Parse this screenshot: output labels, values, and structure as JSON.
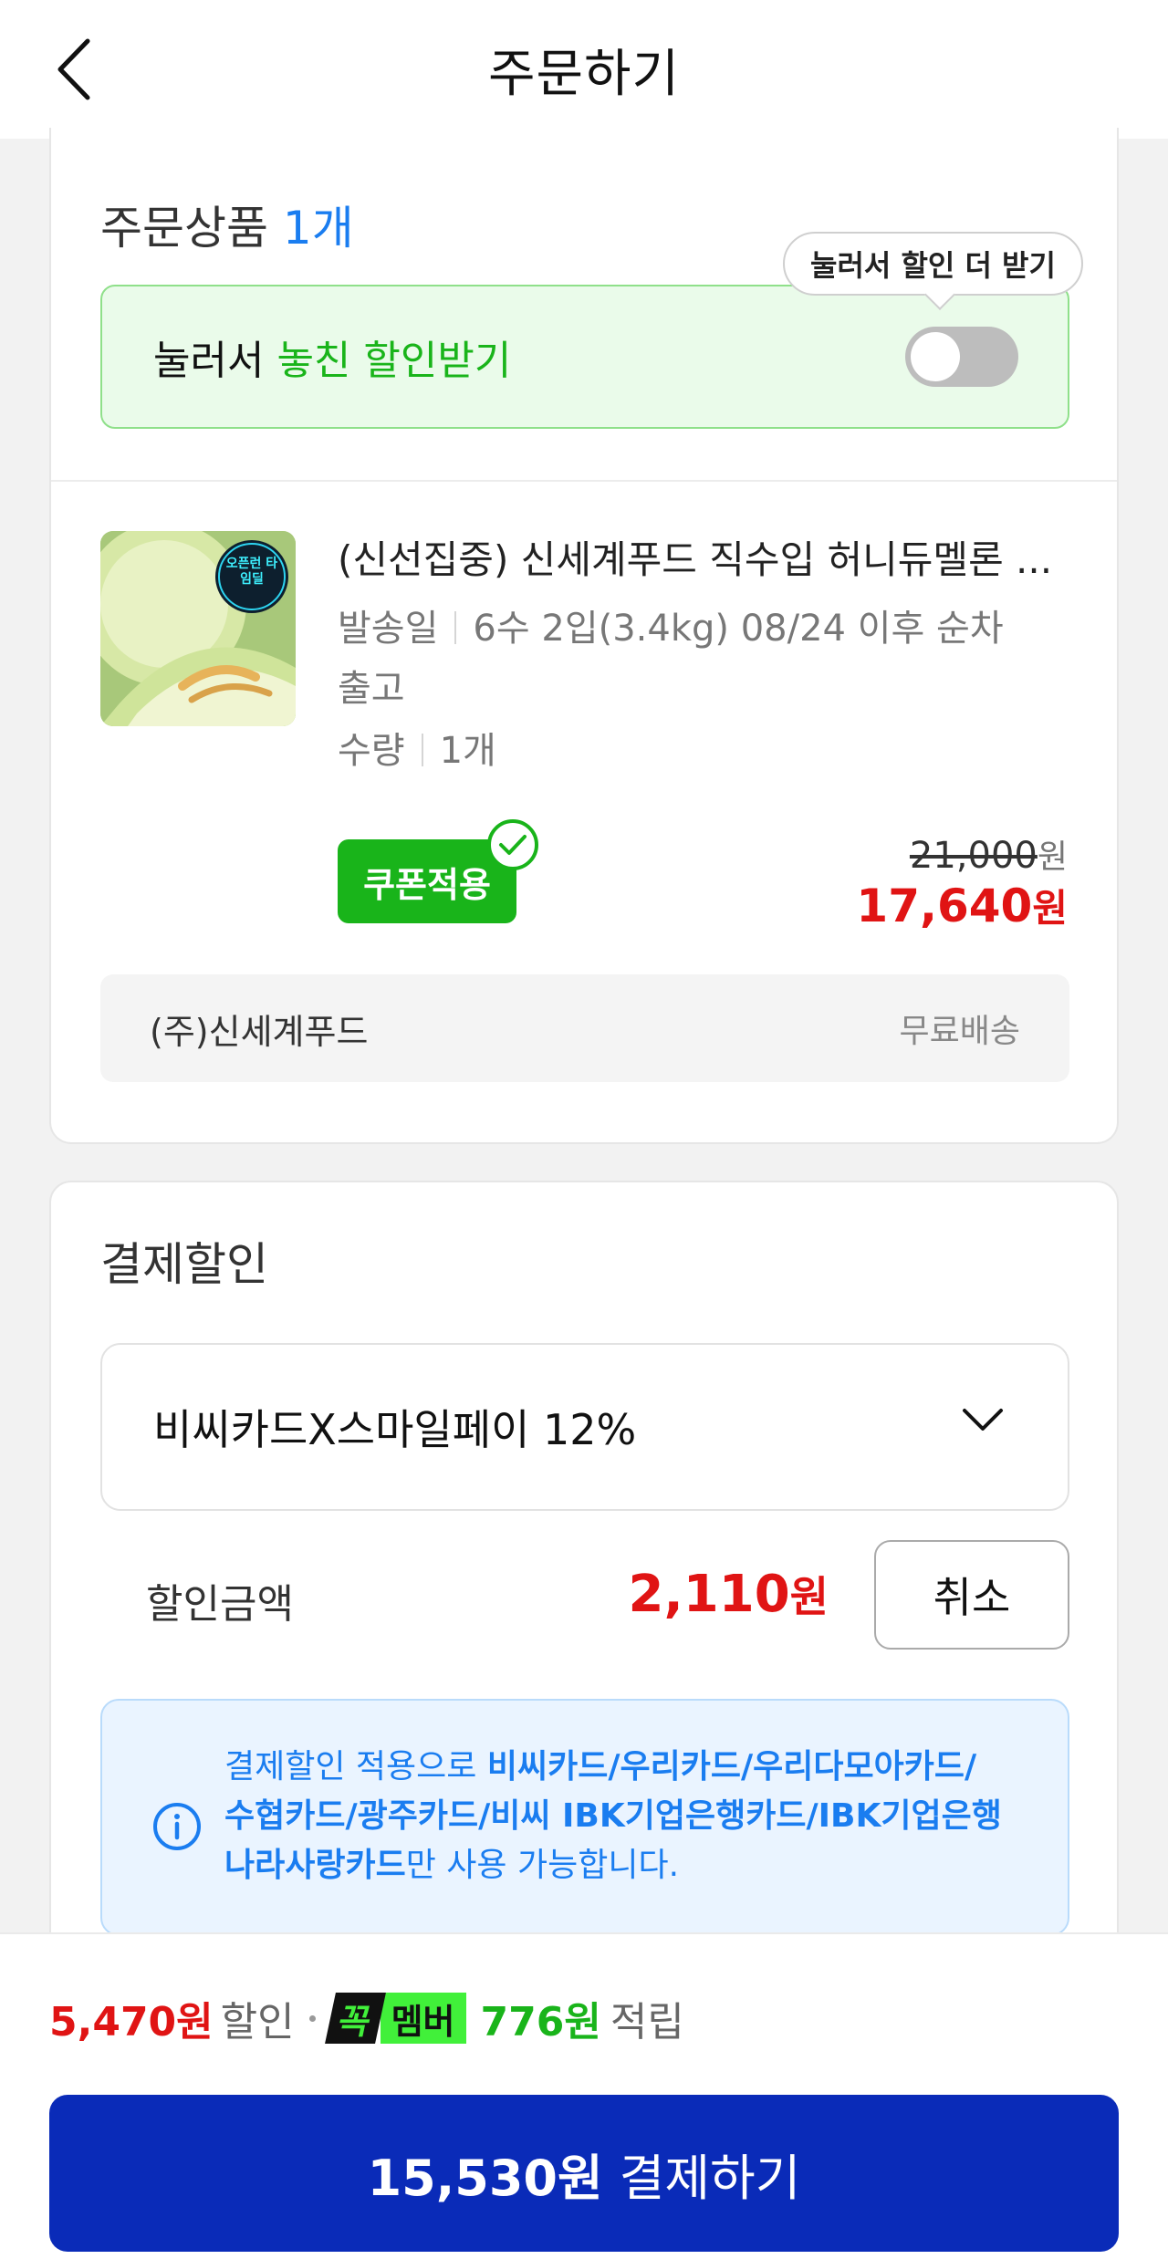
{
  "header": {
    "title": "주문하기"
  },
  "products": {
    "section_title": "주문상품",
    "count": "1개",
    "tooltip": "눌러서 할인 더 받기",
    "promo_prefix": "눌러서",
    "promo_highlight": "놓친 할인받기",
    "toggle_on": false,
    "item": {
      "name": "(신선집중) 신세계푸드 직수입 허니듀멜론 ...",
      "ship_label": "발송일",
      "ship_value": "6수 2입(3.4kg) 08/24 이후 순차",
      "ship_value_2": "출고",
      "qty_label": "수량",
      "qty_value": "1개",
      "thumb_badge": "오픈런 타임딜",
      "coupon_badge": "쿠폰적용",
      "price_original": "21,000",
      "price_original_unit": "원",
      "price_final": "17,640",
      "price_final_unit": "원"
    },
    "seller": {
      "name": "(주)신세계푸드",
      "shipping": "무료배송"
    }
  },
  "discount": {
    "section_title": "결제할인",
    "selected_card": "비씨카드X스마일페이 12%",
    "amount_label": "할인금액",
    "amount": "2,110",
    "amount_unit": "원",
    "cancel_label": "취소",
    "info_prefix": "결제할인 적용으로 ",
    "info_cards_line1": "비씨카드/우리카드/우리다모아카드/",
    "info_cards_line2": "수협카드/광주카드/비씨 IBK기업은행카드/IBK기업은행",
    "info_cards_line3": "나라사랑카드",
    "info_suffix": "만 사용 가능합니다."
  },
  "summary": {
    "discount_amount": "5,470원",
    "discount_label": "할인",
    "member_badge_1": "꼭",
    "member_badge_2": "멤버",
    "points": "776원",
    "points_label": "적립"
  },
  "pay": {
    "amount": "15,530원",
    "label": "결제하기"
  },
  "colors": {
    "accent_blue": "#0a2bb8",
    "sale_red": "#e01414",
    "green": "#19b41a",
    "info_blue": "#1a7df0"
  }
}
